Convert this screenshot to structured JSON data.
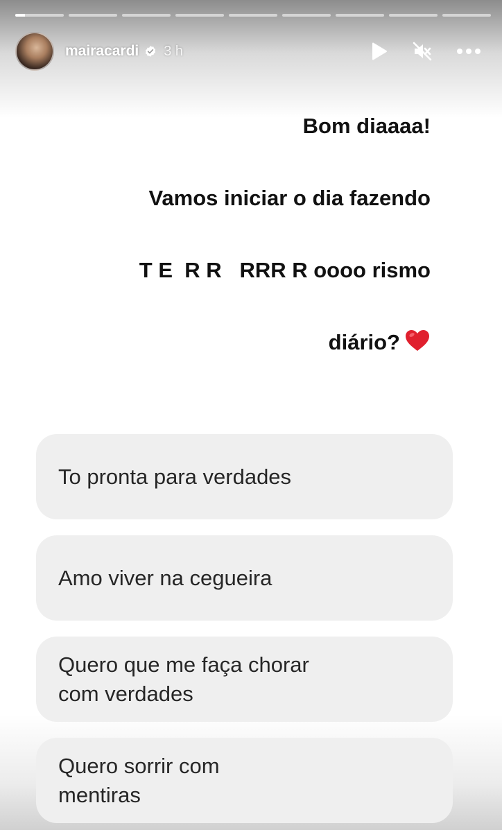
{
  "story": {
    "segments_total": 9,
    "current_segment_progress": 0.2
  },
  "header": {
    "username": "mairacardi",
    "time": "3 h",
    "verified": true
  },
  "message": {
    "lines": [
      "Bom diaaaa!",
      "Vamos iniciar o dia fazendo",
      "T E  R R   RRR R oooo rismo",
      "diário?"
    ],
    "heart_emoji": "❤️"
  },
  "poll": {
    "options": [
      "To pronta para verdades",
      "Amo viver na cegueira",
      "Quero que me faça chorar com verdades",
      "Quero sorrir com mentiras"
    ]
  },
  "icons": {
    "play": "play-icon",
    "mute": "speaker-muted-icon",
    "more": "more-options-icon",
    "verified": "verified-badge-icon"
  },
  "colors": {
    "option_bg": "#efefef",
    "text": "#111111",
    "heart": "#e0202e"
  }
}
